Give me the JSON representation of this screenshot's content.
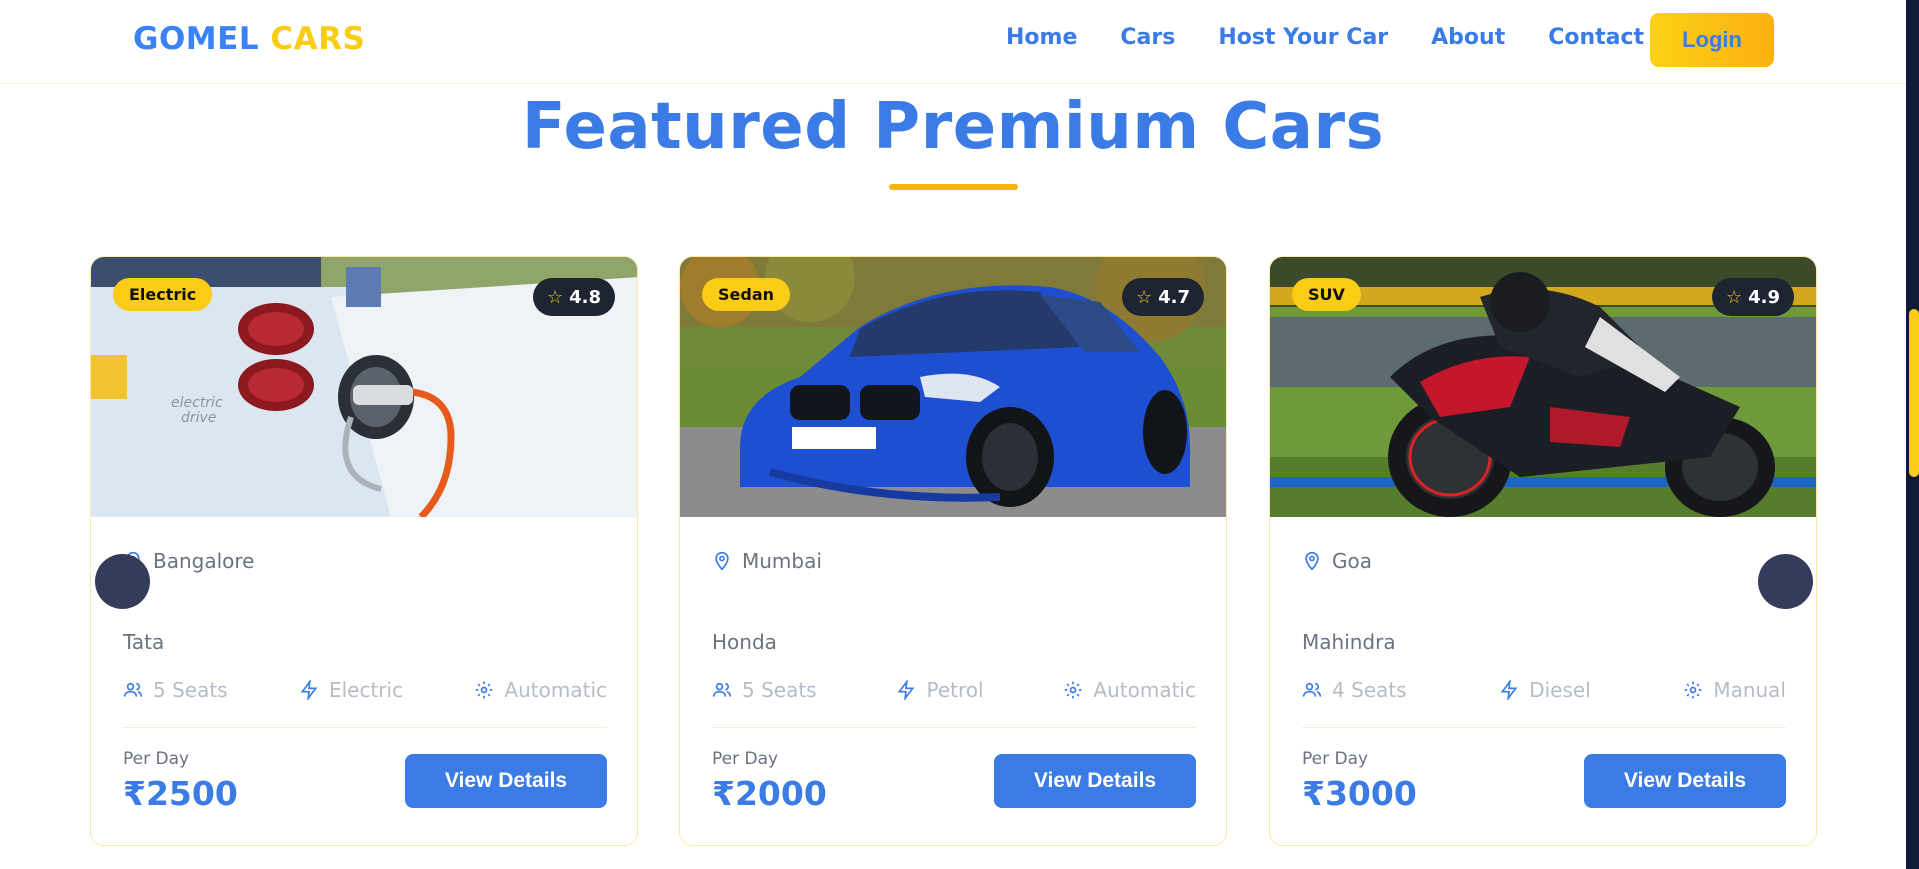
{
  "header": {
    "logo_part1": "GOMEL",
    "logo_part2": "CARS",
    "nav": [
      {
        "label": "Home"
      },
      {
        "label": "Cars"
      },
      {
        "label": "Host Your Car"
      },
      {
        "label": "About"
      },
      {
        "label": "Contact"
      }
    ],
    "login_label": "Login"
  },
  "section": {
    "title": "Featured Premium Cars"
  },
  "cards": [
    {
      "category": "Electric",
      "rating": "4.8",
      "location": "Bangalore",
      "brand": "Tata",
      "seats": "5 Seats",
      "fuel": "Electric",
      "transmission": "Automatic",
      "per_day_label": "Per Day",
      "price": "₹2500",
      "button": "View Details"
    },
    {
      "category": "Sedan",
      "rating": "4.7",
      "location": "Mumbai",
      "brand": "Honda",
      "seats": "5 Seats",
      "fuel": "Petrol",
      "transmission": "Automatic",
      "per_day_label": "Per Day",
      "price": "₹2000",
      "button": "View Details"
    },
    {
      "category": "SUV",
      "rating": "4.9",
      "location": "Goa",
      "brand": "Mahindra",
      "seats": "4 Seats",
      "fuel": "Diesel",
      "transmission": "Manual",
      "per_day_label": "Per Day",
      "price": "₹3000",
      "button": "View Details"
    }
  ],
  "colors": {
    "primary_blue": "#3b7be6",
    "accent_yellow": "#facc15",
    "dark_badge": "#1f2433",
    "scrollbar_track": "#0f1a36"
  }
}
